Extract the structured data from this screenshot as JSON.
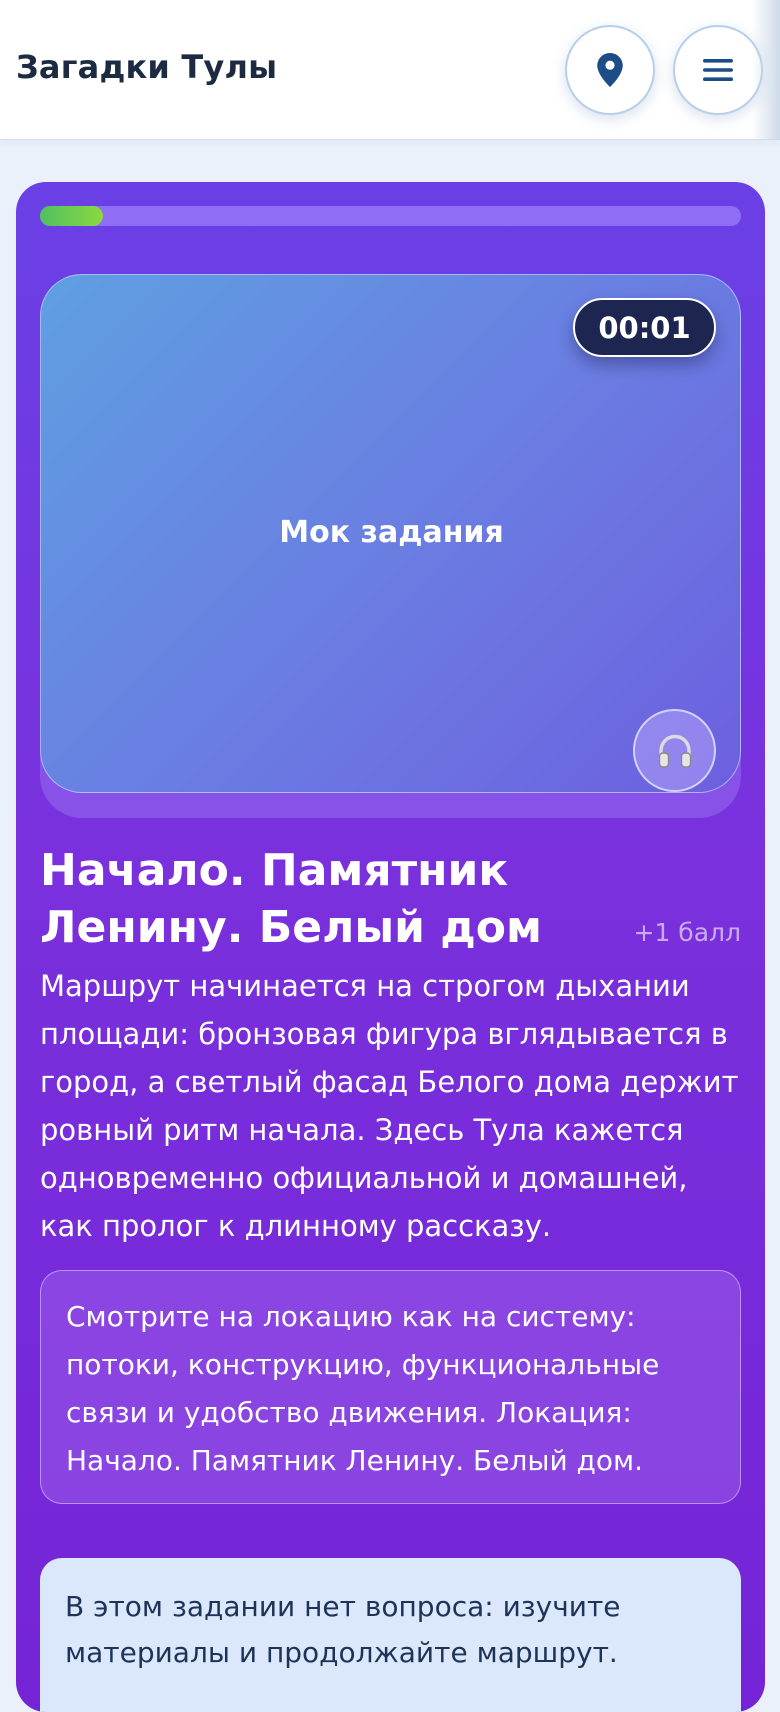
{
  "header": {
    "title": "Загадки Тулы",
    "map_button_icon": "map-pin-icon",
    "menu_button_icon": "hamburger-menu-icon"
  },
  "progress": {
    "fraction": 0.09,
    "fill_color": "#4fc060",
    "track_color": "#9d86f2"
  },
  "media": {
    "timer": "00:01",
    "placeholder_label": "Мок задания",
    "audio_icon": "headphones-icon"
  },
  "task": {
    "title": "Начало. Памятник Ленину. Белый дом",
    "points": "+1 балл",
    "description": "Маршрут начинается на строгом дыхании площади: бронзовая фигура вглядывается в город, а светлый фасад Белого дома держит ровный ритм начала. Здесь Тула кажется одновременно официальной и домашней, как пролог к длинному рассказу.",
    "hint": "Смотрите на локацию как на систему: потоки, конструкцию, функциональные связи и удобство движения. Локация: Начало. Памятник Ленину. Белый дом.",
    "note": "В этом задании нет вопроса: изучите материалы и продолжайте маршрут."
  },
  "colors": {
    "accent": "#1d4d87",
    "card_top": "#6a40e6",
    "card_bottom": "#7424d6",
    "timer_bg": "#1d2650"
  }
}
